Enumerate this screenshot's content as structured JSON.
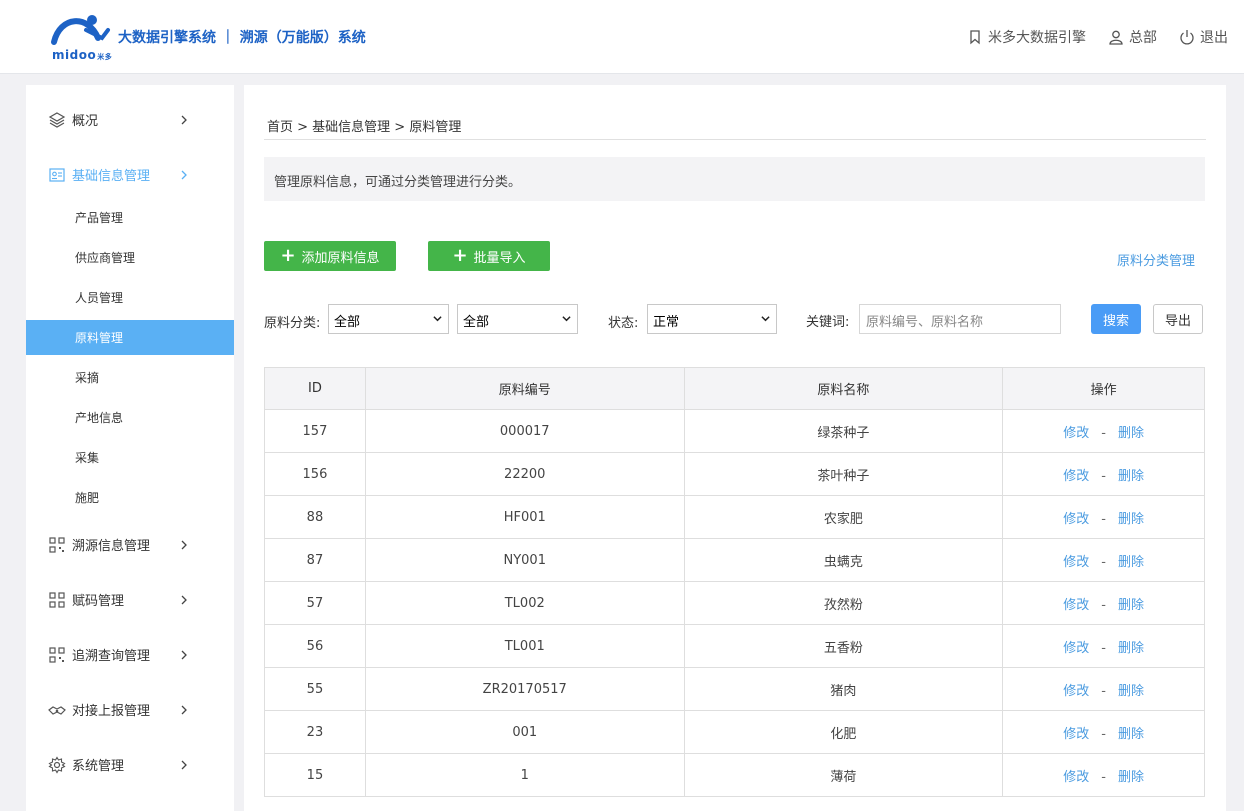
{
  "header": {
    "logo_text": "midoo",
    "logo_sub": "米多",
    "title": "大数据引擎系统 ｜ 溯源（万能版）系统",
    "bookmark_label": "米多大数据引擎",
    "user_label": "总部",
    "logout_label": "退出"
  },
  "sidebar": {
    "items": [
      {
        "label": "概况",
        "icon": "layers-icon"
      },
      {
        "label": "基础信息管理",
        "icon": "id-card-icon"
      },
      {
        "label": "溯源信息管理",
        "icon": "qr-grid-icon"
      },
      {
        "label": "赋码管理",
        "icon": "qr-grid-icon"
      },
      {
        "label": "追溯查询管理",
        "icon": "qr-grid-icon"
      },
      {
        "label": "对接上报管理",
        "icon": "handshake-icon"
      },
      {
        "label": "系统管理",
        "icon": "gear-icon"
      }
    ],
    "sub_items": [
      "产品管理",
      "供应商管理",
      "人员管理",
      "原料管理",
      "采摘",
      "产地信息",
      "采集",
      "施肥"
    ],
    "active_color": "#5ab0f4"
  },
  "main": {
    "breadcrumb": "首页 > 基础信息管理 > 原料管理",
    "notice": "管理原料信息，可通过分类管理进行分类。",
    "add_button": "添加原料信息",
    "import_button": "批量导入",
    "category_link": "原料分类管理",
    "filters": {
      "category_label": "原料分类:",
      "category_value_1": "全部",
      "category_value_2": "全部",
      "status_label": "状态:",
      "status_value": "正常",
      "keyword_label": "关键词:",
      "keyword_placeholder": "原料编号、原料名称"
    },
    "search_button": "搜索",
    "export_button": "导出",
    "table": {
      "headers": [
        "ID",
        "原料编号",
        "原料名称",
        "操作"
      ],
      "edit_label": "修改",
      "op_separator": "-",
      "delete_label": "删除",
      "rows": [
        {
          "id": "157",
          "code": "000017",
          "name": "绿茶种子"
        },
        {
          "id": "156",
          "code": "22200",
          "name": "茶叶种子"
        },
        {
          "id": "88",
          "code": "HF001",
          "name": "农家肥"
        },
        {
          "id": "87",
          "code": "NY001",
          "name": "虫螨克"
        },
        {
          "id": "57",
          "code": "TL002",
          "name": "孜然粉"
        },
        {
          "id": "56",
          "code": "TL001",
          "name": "五香粉"
        },
        {
          "id": "55",
          "code": "ZR20170517",
          "name": "猪肉"
        },
        {
          "id": "23",
          "code": "001",
          "name": "化肥"
        },
        {
          "id": "15",
          "code": "1",
          "name": "薄荷"
        }
      ]
    }
  },
  "colors": {
    "brand": "#1d62c5",
    "green_button": "#44b549",
    "search_button": "#4a9cf6",
    "link": "#4a9be0"
  }
}
